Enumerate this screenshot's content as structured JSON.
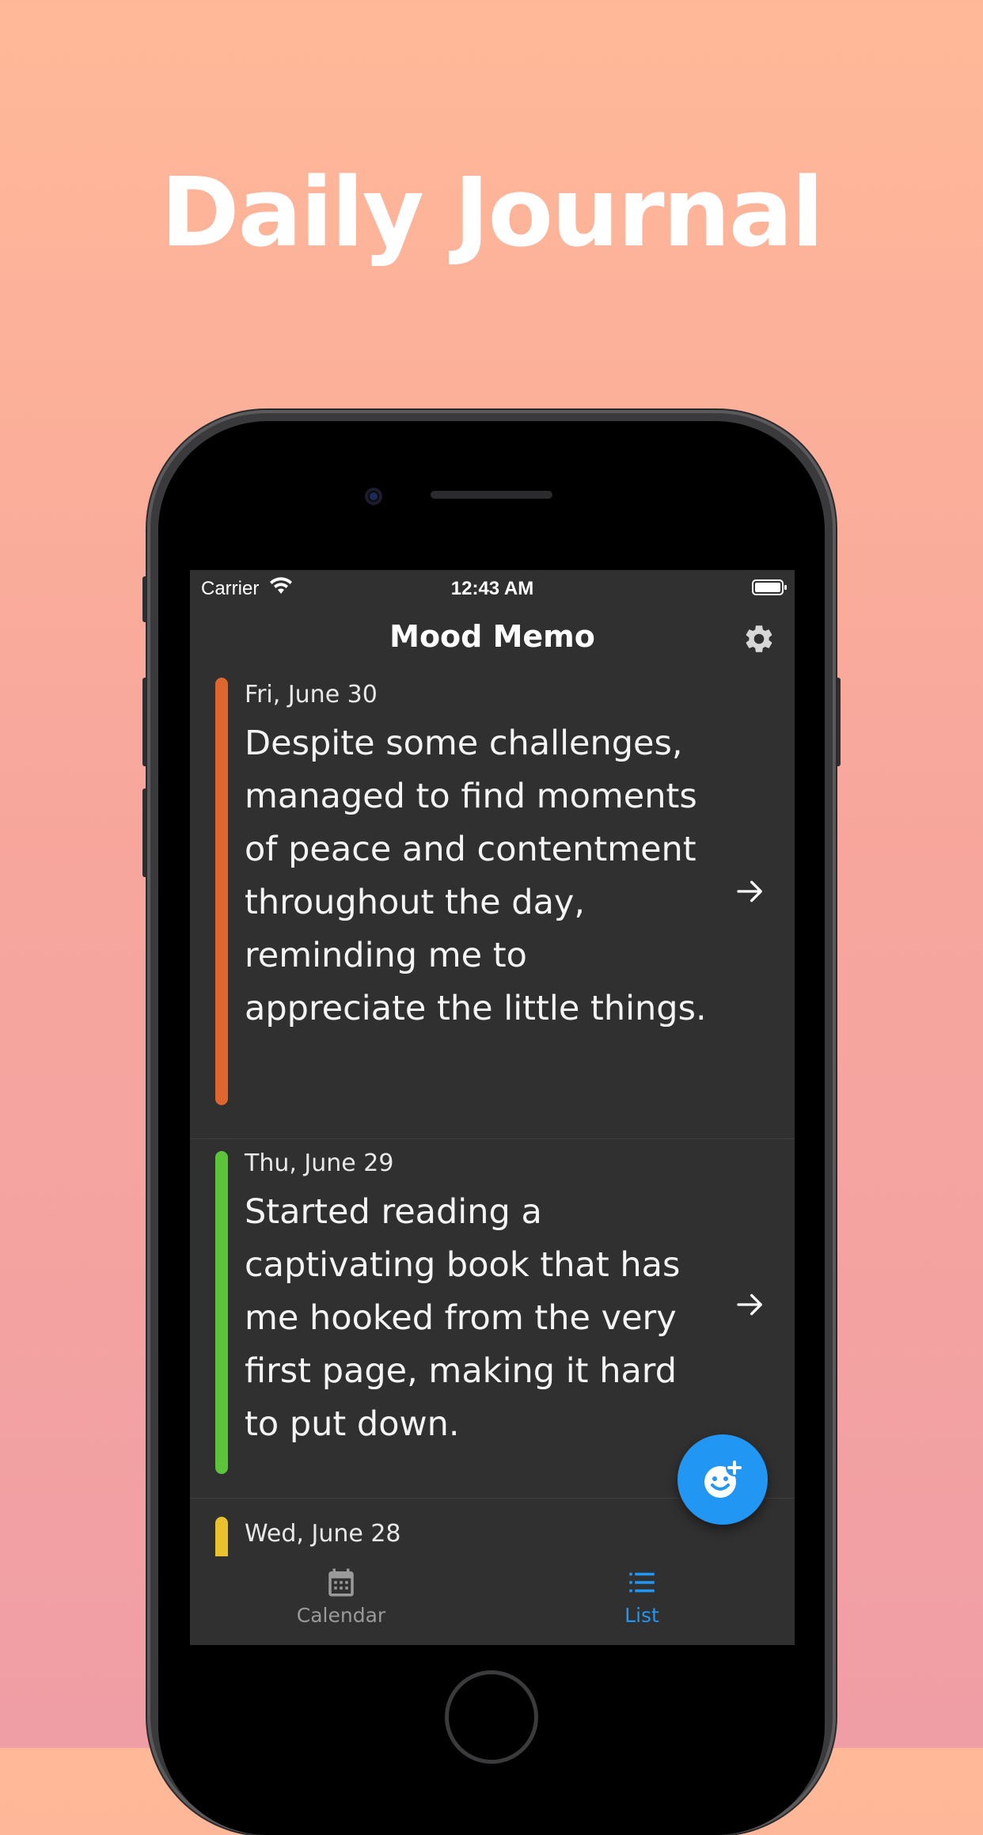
{
  "promo": {
    "headline": "Daily Journal"
  },
  "status_bar": {
    "carrier": "Carrier",
    "time": "12:43 AM"
  },
  "app_bar": {
    "title": "Mood Memo",
    "settings_icon": "gear-icon"
  },
  "entries": [
    {
      "date": "Fri, June 30",
      "text": "Despite some challenges, managed to find moments of peace and contentment throughout the day, reminding me to appreciate the little things.",
      "mood_color": "#e0662f"
    },
    {
      "date": "Thu, June 29",
      "text": "Started reading a captivating book that has me hooked from the very first page, making it hard to put down.",
      "mood_color": "#5cc43b"
    },
    {
      "date": "Wed, June 28",
      "text": "",
      "mood_color": "#e8c12c"
    }
  ],
  "fab": {
    "icon": "add-mood-icon"
  },
  "bottom_nav": {
    "items": [
      {
        "label": "Calendar",
        "icon": "calendar-icon",
        "active": false
      },
      {
        "label": "List",
        "icon": "list-icon",
        "active": true
      }
    ],
    "active_color": "#2196f3",
    "inactive_color": "#9a9a9a"
  },
  "colors": {
    "background_top": "#ffb998",
    "background_bottom": "#f09ea5",
    "screen_bg": "#303030",
    "accent": "#2196f3"
  }
}
